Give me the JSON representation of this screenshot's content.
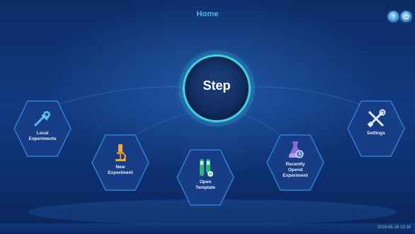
{
  "header": {
    "title": "Home"
  },
  "hub": {
    "label": "Step"
  },
  "buttons": {
    "local": {
      "lines": [
        "Local",
        "Experiments"
      ],
      "icon": "pipette-location-icon"
    },
    "new": {
      "lines": [
        "New",
        "Experiment"
      ],
      "icon": "microscope-icon"
    },
    "template": {
      "lines": [
        "Open",
        "Template"
      ],
      "icon": "test-tubes-icon"
    },
    "recent": {
      "lines": [
        "Recently",
        "Opend",
        "Experiment"
      ],
      "icon": "flask-clock-icon"
    },
    "settings": {
      "lines": [
        "Settings"
      ],
      "icon": "tools-icon"
    }
  },
  "toolbar": {
    "help_icon": "help-icon",
    "power_icon": "power-icon"
  },
  "status": {
    "datetime": "2019-06-28 13:34"
  },
  "colors": {
    "accent": "#3fd2e6",
    "title": "#4fb6ea",
    "hex_border": "#2f7fd0",
    "hex_fill": "#173d86"
  }
}
